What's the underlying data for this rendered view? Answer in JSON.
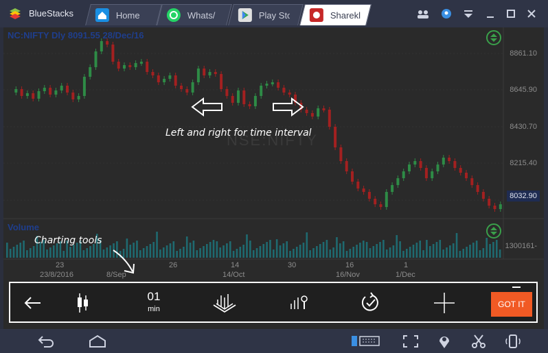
{
  "app": {
    "name": "BlueStacks"
  },
  "tabs": [
    {
      "label": "Home",
      "icon": "home-icon"
    },
    {
      "label": "Whats/",
      "icon": "whatsapp-icon"
    },
    {
      "label": "Play Sto",
      "icon": "play-store-icon"
    },
    {
      "label": "Sharekl",
      "icon": "sharekhan-icon"
    }
  ],
  "chart": {
    "title": "NC:NIFTY Dly 8091.55 28/Dec/16",
    "price_labels": [
      "8861.10",
      "8645.90",
      "8430.70",
      "8215.40"
    ],
    "current_price": "8032.90",
    "watermark": "NSE:NIFTY",
    "volume_label": "Volume",
    "volume_value": "1300161-",
    "dates_top": [
      "23",
      "26",
      "14",
      "30",
      "16",
      "1"
    ],
    "dates_bottom": [
      "23/8/2016",
      "8/Sep",
      "14/Oct",
      "16/Nov",
      "1/Dec"
    ]
  },
  "tutorial": {
    "time_interval_hint": "Left and right for time interval",
    "charting_tools_hint": "Charting tools"
  },
  "toolbar": {
    "interval_value": "01",
    "interval_unit": "min",
    "got_it_label": "GOT IT"
  },
  "colors": {
    "up_candle": "#2e8b46",
    "down_candle": "#a32020",
    "got_it": "#f15a24",
    "title_blue": "#1f3e8c"
  }
}
